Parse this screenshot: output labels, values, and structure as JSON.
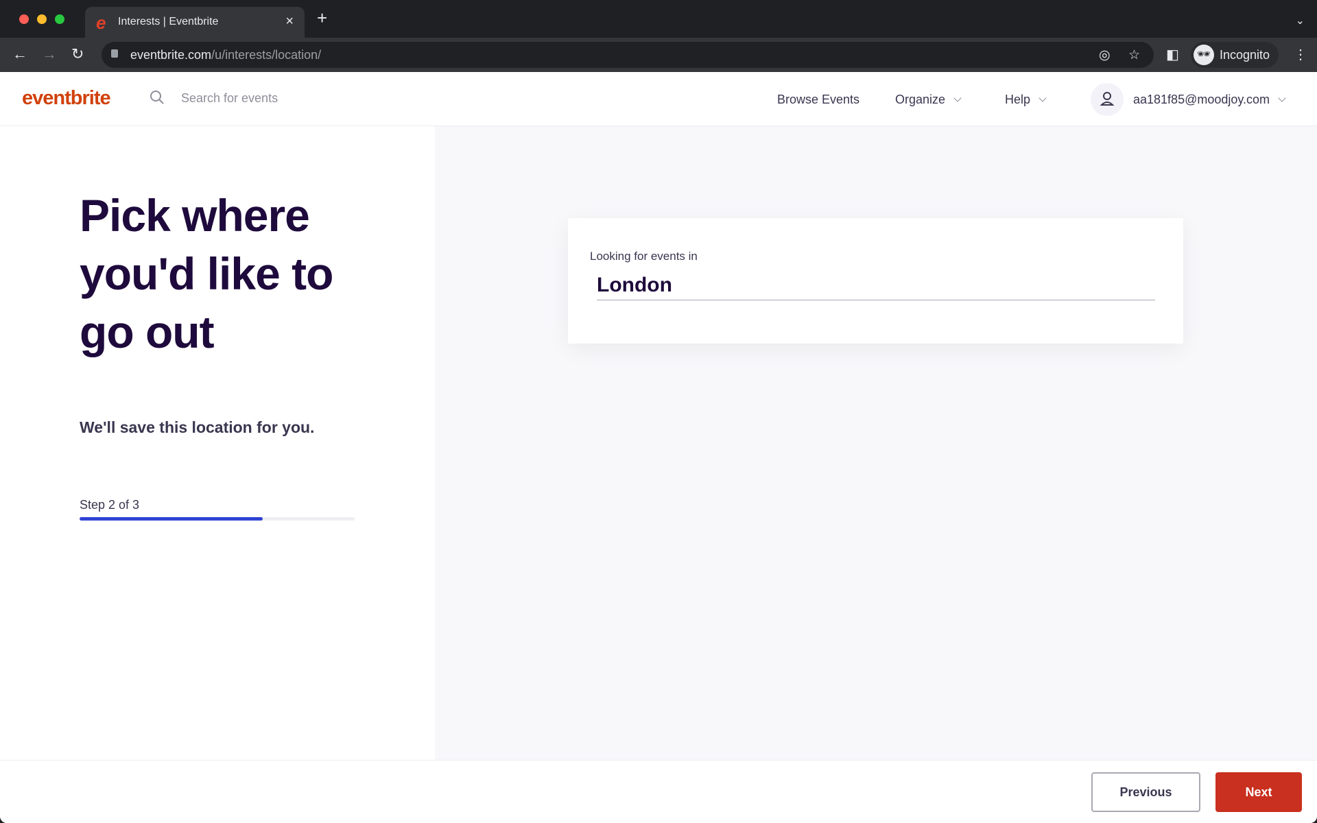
{
  "browser": {
    "tab_title": "Interests | Eventbrite",
    "tab_close": "×",
    "new_tab": "+",
    "url_host": "eventbrite.com",
    "url_path": "/u/interests/location/",
    "profile_label": "Incognito"
  },
  "header": {
    "logo": "eventbrite",
    "search_placeholder": "Search for events",
    "nav": {
      "browse": "Browse Events",
      "organize": "Organize",
      "help": "Help"
    },
    "user_email": "aa181f85@moodjoy.com"
  },
  "left": {
    "title": "Pick where you'd like to go out",
    "subtitle": "We'll save this location for you.",
    "step_label": "Step 2 of 3",
    "progress_percent": 66.7,
    "progress_color": "#2f44d4"
  },
  "card": {
    "label": "Looking for events in",
    "location_value": "London"
  },
  "footer": {
    "previous_label": "Previous",
    "next_label": "Next",
    "next_color": "#c9301f"
  }
}
